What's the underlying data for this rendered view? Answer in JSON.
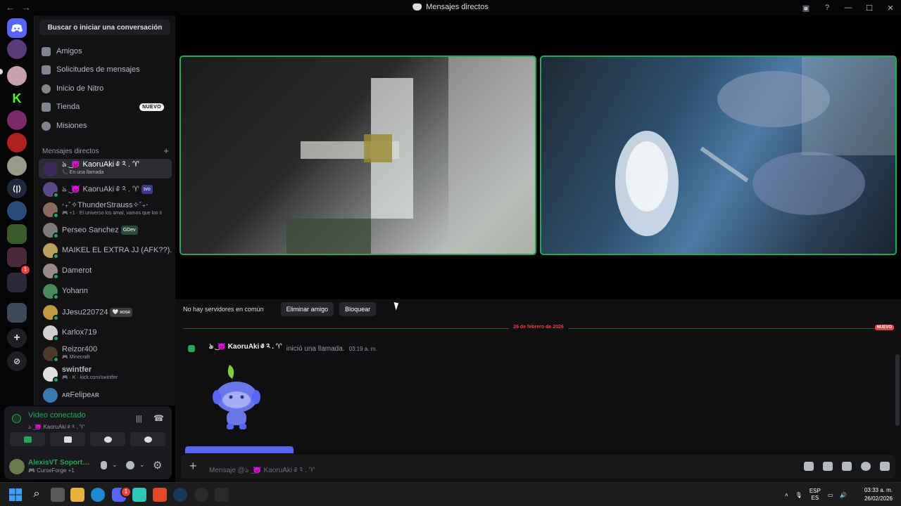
{
  "titlebar": {
    "back": "←",
    "forward": "→",
    "title": "Mensajes directos",
    "inbox_icon": "inbox-icon",
    "help": "?",
    "minimize": "—",
    "maximize": "☐",
    "close": "✕"
  },
  "sidebar": {
    "search_label": "Buscar o iniciar una conversación",
    "nav": [
      {
        "label": "Amigos",
        "icon": "friends-icon"
      },
      {
        "label": "Solicitudes de mensajes",
        "icon": "mail-icon"
      },
      {
        "label": "Inicio de Nitro",
        "icon": "nitro-icon"
      },
      {
        "label": "Tienda",
        "icon": "shop-icon",
        "badge": "NUEVO"
      },
      {
        "label": "Misiones",
        "icon": "quests-icon"
      }
    ],
    "dm_header": "Mensajes directos",
    "dm_add": "+",
    "dms": [
      {
        "name": "ঌ ͜ 👿 KaoruAki ༅ ༢ . ♈",
        "sub": "📞 En una llamada",
        "color": "#3b2a5a"
      },
      {
        "name": "ঌ ͜ 👿 KaoruAki ༅ ༢ . ♈",
        "tag": "ɪᴠᴏ",
        "sub": "",
        "color": "#5a4a8a"
      },
      {
        "name": "‧₊˚✧ThunderStrauss✧˚₊‧",
        "sub": "🎮 +1 · El universo los amal, vamos que los ti",
        "color": "#8a6a5a"
      },
      {
        "name": "Perseo Sanchez",
        "tag": "GDev",
        "sub": "",
        "color": "#7a7a7a"
      },
      {
        "name": "MAIKEL EL EXTRA JJ (AFK??)...",
        "sub": "",
        "color": "#b8a060"
      },
      {
        "name": "Damerot",
        "sub": "",
        "color": "#9a8a8a"
      },
      {
        "name": "Yohann",
        "sub": "",
        "color": "#4a8a5a"
      },
      {
        "name": "JJesu220724",
        "tag": "🤍 ʀᴏsʀ",
        "sub": "",
        "color": "#c09a40"
      },
      {
        "name": "Karlox719",
        "sub": "",
        "color": "#d0d0d0"
      },
      {
        "name": "Reizor400",
        "sub": "🎮 Minecraft",
        "color": "#4a3a2a"
      },
      {
        "name": "swintfer",
        "sub": "🎮 · K · kick.com/swintfer",
        "color": "#e0e0e0"
      },
      {
        "name": "ᴀʀFelipeᴀʀ",
        "sub": "",
        "color": "#3a7ab0"
      }
    ]
  },
  "voice": {
    "status": "Video conectado",
    "channel": "ঌ ͜ 👿 KaoruAki ༅ ༢ . ♈",
    "buttons": [
      "camera-icon",
      "screen-share-icon",
      "activities-icon",
      "soundboard-icon"
    ]
  },
  "user": {
    "name": "AlexisVT Soporte...",
    "status": "🎮 CurseForge +1"
  },
  "chat": {
    "no_servers": "No hay servidores en común",
    "remove_friend": "Eliminar amigo",
    "block": "Bloquear",
    "date": "26 de febrero de 2026",
    "new_badge": "NUEVO",
    "call_user": "ঌ ͜ 👿 KaoruAki ༅ ༢ . ♈",
    "call_text": "inició una llamada.",
    "call_time": "03:19 a. m.",
    "composer_placeholder": "Mensaje @ঌ ͜ 👿 KaoruAki ༅ ༢ . ♈"
  },
  "taskbar": {
    "lang1": "ESP",
    "lang2": "ES",
    "time": "03:33 a. m.",
    "date": "26/02/2026",
    "discord_badge": "1"
  }
}
